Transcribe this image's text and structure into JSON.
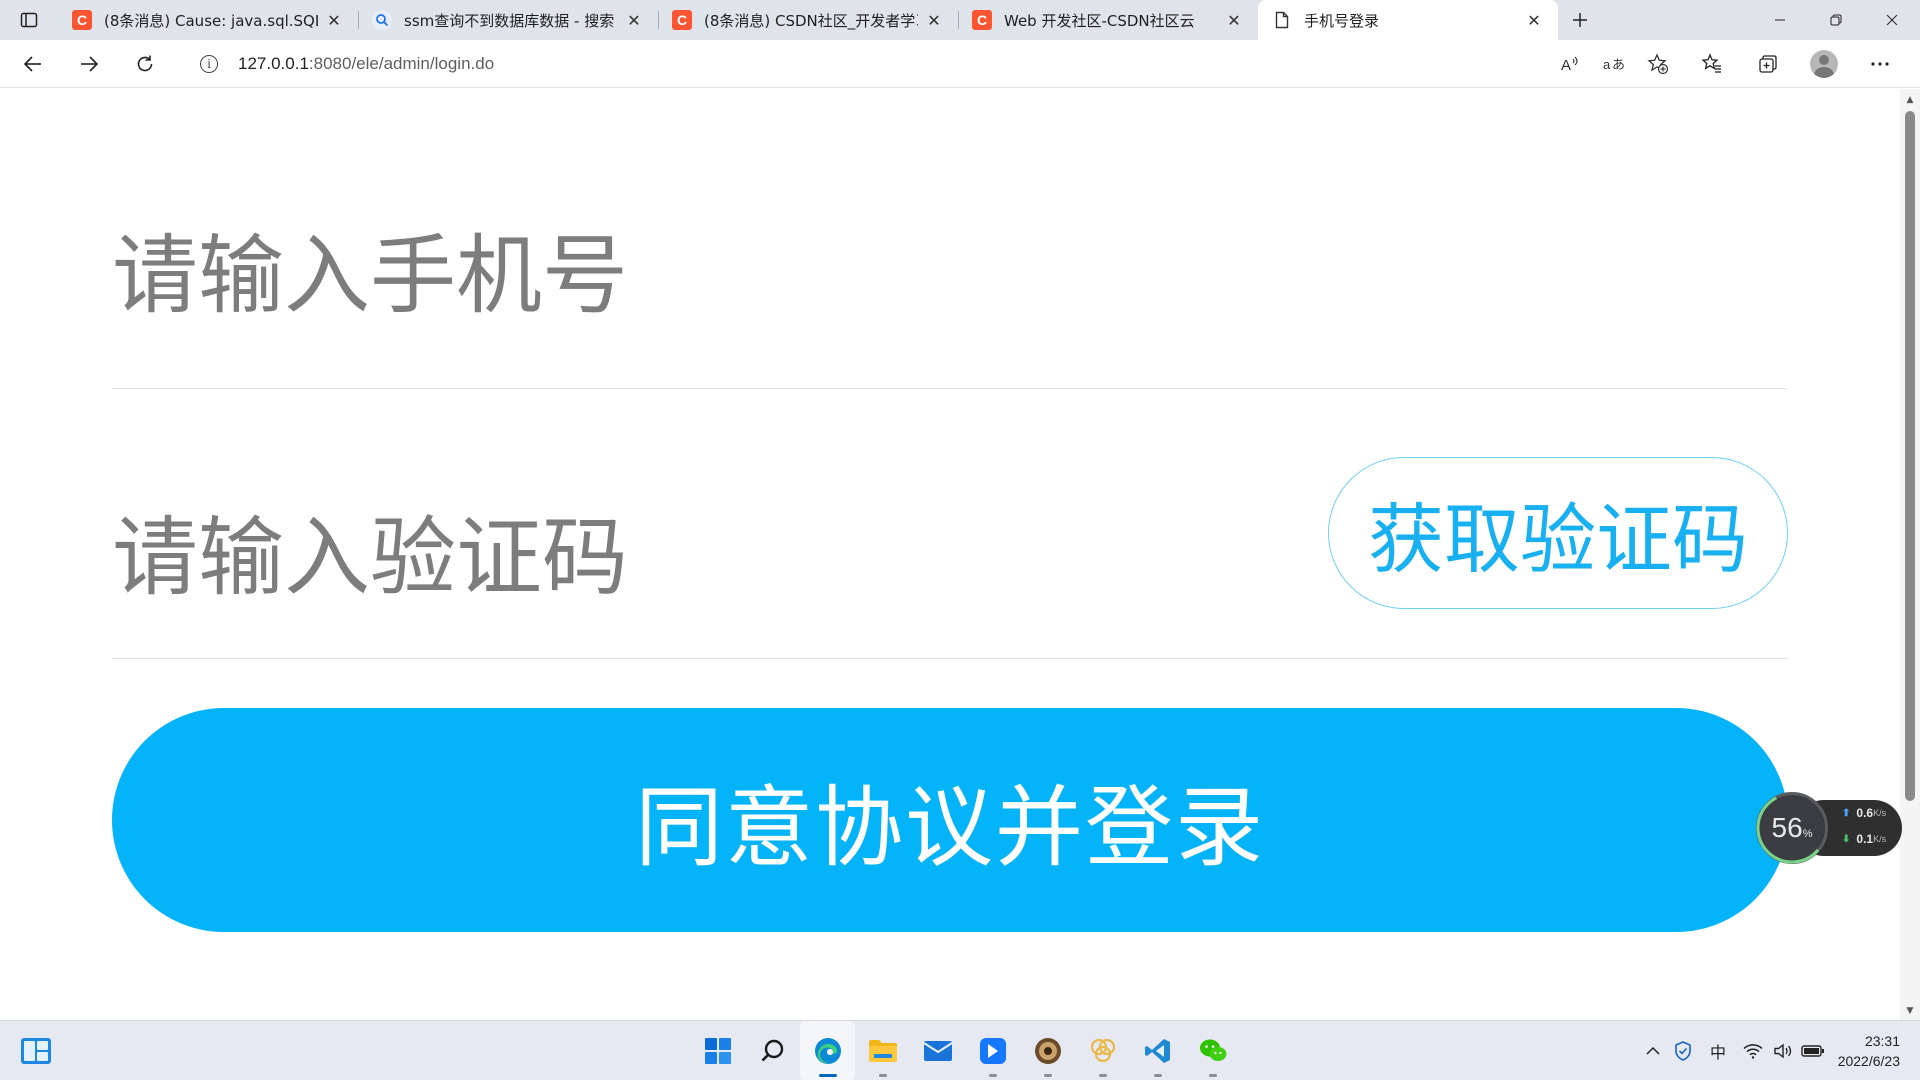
{
  "browser": {
    "tabs": [
      {
        "title": "(8条消息) Cause: java.sql.SQLInte",
        "favicon": "csdn-icon",
        "active": false
      },
      {
        "title": "ssm查询不到数据库数据 - 搜索",
        "favicon": "search-icon",
        "active": false
      },
      {
        "title": "(8条消息) CSDN社区_开发者学习",
        "favicon": "csdn-icon",
        "active": false
      },
      {
        "title": "Web 开发社区-CSDN社区云",
        "favicon": "csdn-icon",
        "active": false
      },
      {
        "title": "手机号登录",
        "favicon": "page-icon",
        "active": true
      }
    ],
    "csdn_glyph": "C",
    "address": {
      "host": "127.0.0.1",
      "rest": ":8080/ele/admin/login.do"
    }
  },
  "form": {
    "phone_placeholder": "请输入手机号",
    "code_placeholder": "请输入验证码",
    "get_code_label": "获取验证码",
    "login_label": "同意协议并登录"
  },
  "monitor": {
    "cpu_percent": "56",
    "pct_sign": "%",
    "upload": "0.6",
    "download": "0.1",
    "unit": "K/s"
  },
  "taskbar": {
    "time": "23:31",
    "date": "2022/6/23",
    "ime": "中"
  },
  "colors": {
    "accent": "#05b3f9",
    "get_code_text": "#18b0f0",
    "placeholder": "#7d7d7d"
  }
}
